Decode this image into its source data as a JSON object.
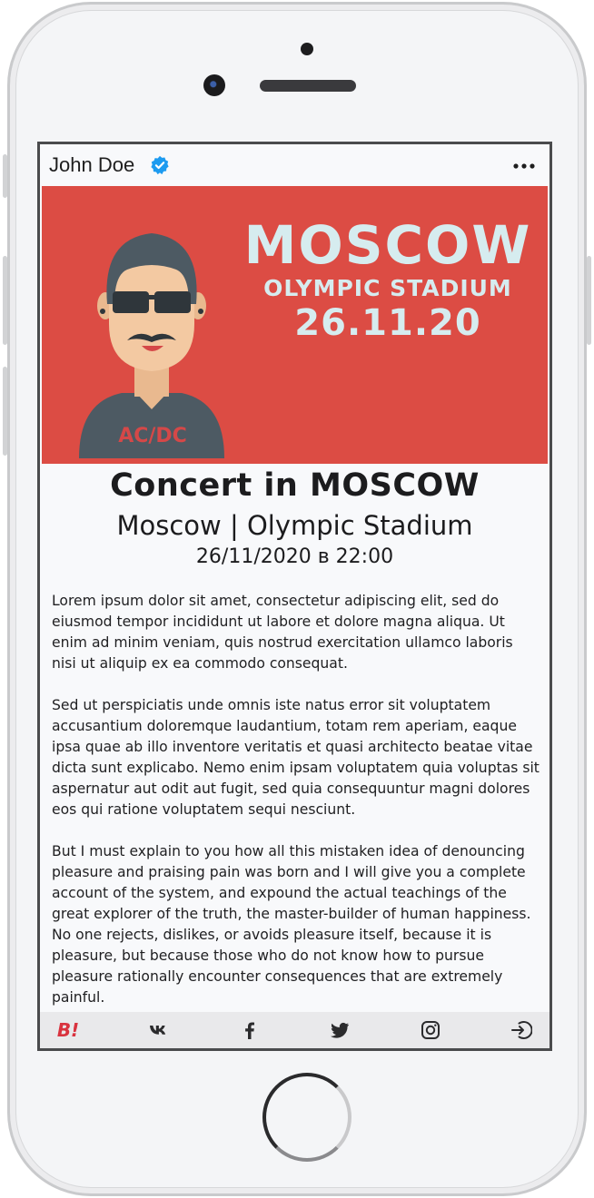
{
  "profile": {
    "name": "John Doe",
    "verified": true
  },
  "banner": {
    "city": "MOSCOW",
    "venue": "OLYMPIC STADIUM",
    "date": "26.11.20",
    "shirt_text": "AC/DC",
    "background": "#dc4c44",
    "text_color": "#d6ecef"
  },
  "event": {
    "title": "Concert in MOSCOW",
    "location": "Moscow | Olympic Stadium",
    "datetime": "26/11/2020 в 22:00"
  },
  "description": [
    "Lorem ipsum dolor sit amet, consectetur adipiscing elit, sed do eiusmod tempor incididunt ut labore et dolore magna aliqua. Ut enim ad minim veniam, quis nostrud exercitation ullamco laboris nisi ut aliquip ex ea commodo consequat.",
    "Sed ut perspiciatis unde omnis iste natus error sit voluptatem accusantium doloremque laudantium, totam rem aperiam, eaque ipsa quae ab illo inventore veritatis et quasi architecto beatae vitae dicta sunt explicabo. Nemo enim ipsam voluptatem quia voluptas sit aspernatur aut odit aut fugit, sed quia consequuntur magni dolores eos qui ratione voluptatem sequi nesciunt.",
    "But I must explain to you how all this mistaken idea of denouncing pleasure and praising pain was born and I will give you a complete account of the system, and expound the actual teachings of the great explorer of the truth, the master-builder of human happiness. No one rejects, dislikes, or avoids pleasure itself, because it is pleasure, but because those who do not know how to pursue pleasure rationally encounter consequences that are extremely painful."
  ],
  "icons": {
    "verified": "verified-badge-icon",
    "menu": "more-horizontal-icon",
    "bottom_bar": [
      "behance-icon",
      "vk-icon",
      "facebook-icon",
      "twitter-icon",
      "instagram-icon",
      "sign-in-icon"
    ]
  },
  "behance_label": "B!",
  "colors": {
    "verified": "#1d9bf0",
    "behance": "#d9333f",
    "screen_bg": "#f8f9fb",
    "bottom_bar": "#e9e9eb"
  }
}
